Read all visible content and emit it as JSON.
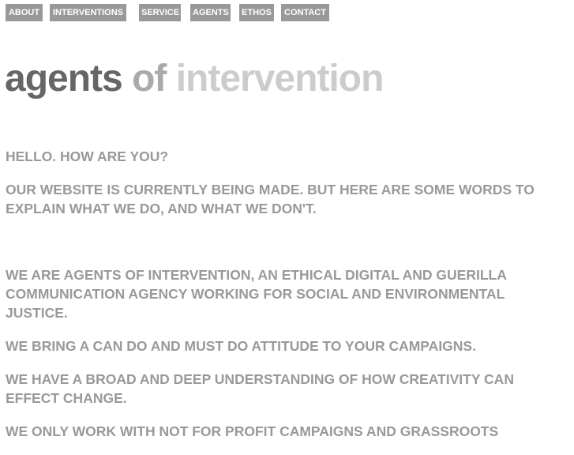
{
  "nav": {
    "items": [
      {
        "label": "ABOUT"
      },
      {
        "label": "INTERVENTIONS"
      },
      {
        "label": "SERVICE"
      },
      {
        "label": "AGENTS"
      },
      {
        "label": "ETHOS"
      },
      {
        "label": "CONTACT"
      }
    ]
  },
  "logo": {
    "word1": "agents",
    "word2": "of",
    "word3": "intervention"
  },
  "content": {
    "greeting": "HELLO. HOW ARE YOU?",
    "intro": "OUR WEBSITE IS CURRENTLY BEING MADE. BUT HERE ARE SOME WORDS TO EXPLAIN WHAT WE DO, AND WHAT WE DON'T.",
    "paragraphs": [
      "WE ARE AGENTS OF INTERVENTION, AN ETHICAL DIGITAL AND GUERILLA COMMUNICATION AGENCY WORKING FOR SOCIAL AND ENVIRONMENTAL JUSTICE.",
      "WE BRING A CAN DO AND MUST DO ATTITUDE TO YOUR CAMPAIGNS.",
      "WE HAVE A BROAD AND DEEP UNDERSTANDING OF HOW CREATIVITY CAN EFFECT CHANGE.",
      "WE ONLY WORK WITH NOT FOR PROFIT CAMPAIGNS AND GRASSROOTS"
    ]
  },
  "colors": {
    "nav_background": "#999999",
    "nav_text": "#ffffff",
    "logo_dark": "#666666",
    "logo_mid": "#aaaaaa",
    "logo_light": "#cccccc",
    "body_text": "#999999"
  }
}
